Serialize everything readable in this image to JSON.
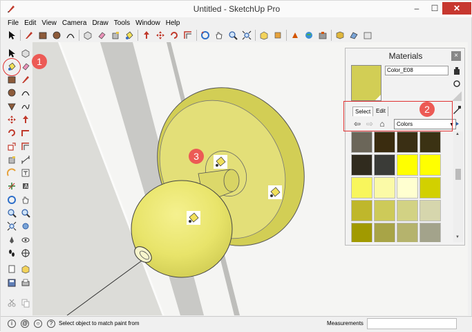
{
  "window": {
    "title": "Untitled - SketchUp Pro",
    "minimize": "–",
    "maximize": "☐",
    "close": "✕"
  },
  "menu": [
    "File",
    "Edit",
    "View",
    "Camera",
    "Draw",
    "Tools",
    "Window",
    "Help"
  ],
  "statusbar": {
    "hint": "Select object to match paint from",
    "measurements_label": "Measurements"
  },
  "materials": {
    "title": "Materials",
    "close": "×",
    "material_name": "Color_E08",
    "tab_select": "Select",
    "tab_edit": "Edit",
    "library": "Colors",
    "swatch_color": "#d2ce55",
    "grid_colors": [
      [
        "#6b6659",
        "#3a2c0f",
        "#3a2f14",
        "#3b3213"
      ],
      [
        "#302b1e",
        "#3a3b37",
        "#ffff00",
        "#ffff00"
      ],
      [
        "#f8f65c",
        "#fbfaa7",
        "#ffffd0",
        "#d2d000"
      ],
      [
        "#bfb72b",
        "#cdca59",
        "#d2d284",
        "#d6d6ad"
      ],
      [
        "#a19a00",
        "#a8a447",
        "#b5b36d",
        "#a3a38b"
      ],
      [
        "#a7a060",
        "#aaa67a",
        "#b2b08f",
        "#cbcab2"
      ]
    ]
  },
  "annotations": {
    "badge1": "1",
    "badge2": "2",
    "badge3": "3"
  },
  "colors": {
    "accent_red": "#e03131",
    "badge_red": "#ec5a55",
    "object_yellow": "#e8e46a"
  }
}
